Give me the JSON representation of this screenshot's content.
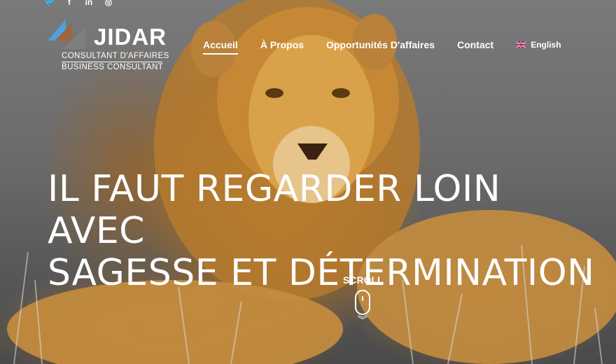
{
  "social": [
    {
      "icon": "twitter-icon",
      "glyph": "🐦"
    },
    {
      "icon": "facebook-icon",
      "glyph": "f"
    },
    {
      "icon": "linkedin-icon",
      "glyph": "in"
    },
    {
      "icon": "instagram-icon",
      "glyph": "◎"
    }
  ],
  "logo": {
    "name": "JIDAR",
    "line1": "CONSULTANT D'AFFAIRES",
    "line2": "BUSINESS CONSULTANT"
  },
  "nav": {
    "items": [
      {
        "label": "Accueil",
        "active": true
      },
      {
        "label": "À Propos",
        "active": false
      },
      {
        "label": "Opportunités D'affaires",
        "active": false
      },
      {
        "label": "Contact",
        "active": false
      }
    ],
    "language": "English"
  },
  "hero": {
    "headline_line1": "IL FAUT REGARDER LOIN AVEC",
    "headline_line2": "SAGESSE ET DÉTERMINATION",
    "scroll_label": "SCROLL"
  },
  "colors": {
    "logo_blue": "#4aa3df",
    "logo_brown": "#a0653a",
    "logo_grey": "#7f7f7f"
  }
}
